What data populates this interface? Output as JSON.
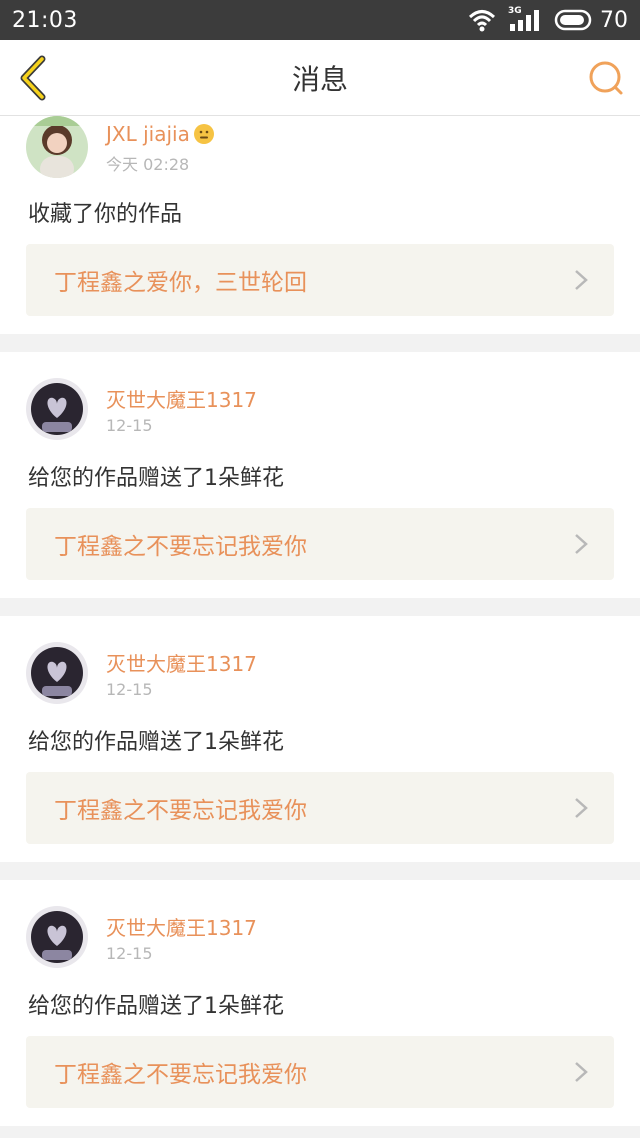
{
  "status_bar": {
    "time": "21:03",
    "network": "3G",
    "battery": "70"
  },
  "nav": {
    "title": "消息"
  },
  "messages": [
    {
      "username": "JXL jiajia",
      "time": "今天 02:28",
      "action": "收藏了你的作品",
      "work_title": "丁程鑫之爱你，三世轮回"
    },
    {
      "username": "灭世大魔王1317",
      "time": "12-15",
      "action": "给您的作品赠送了1朵鲜花",
      "work_title": "丁程鑫之不要忘记我爱你"
    },
    {
      "username": "灭世大魔王1317",
      "time": "12-15",
      "action": "给您的作品赠送了1朵鲜花",
      "work_title": "丁程鑫之不要忘记我爱你"
    },
    {
      "username": "灭世大魔王1317",
      "time": "12-15",
      "action": "给您的作品赠送了1朵鲜花",
      "work_title": "丁程鑫之不要忘记我爱你"
    }
  ],
  "colors": {
    "accent": "#e8915a",
    "status_bar": "#3c3c3c",
    "card_link_bg": "#f5f4ee"
  }
}
